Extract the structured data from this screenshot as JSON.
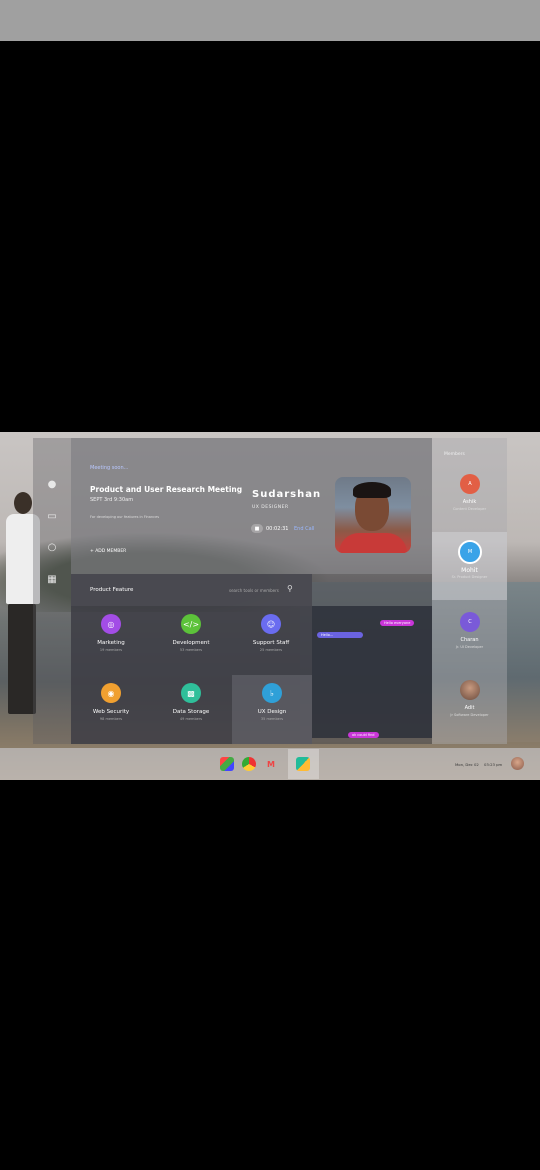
{
  "meeting": {
    "small_label": "Meeting soon...",
    "title": "Product and User Research Meeting",
    "date": "SEPT 3rd 9:30am",
    "note": "For developing our features in Finances",
    "add_member": "+ ADD MEMBER"
  },
  "host": {
    "name": "Sudarshan",
    "role": "UX DESIGNER",
    "call_time": "00:02:31",
    "end_call": "End Call"
  },
  "features": {
    "title": "Product Feature",
    "search_placeholder": "search tools or members",
    "items": [
      {
        "name": "Marketing",
        "members": "19 members",
        "color": "#a34de6"
      },
      {
        "name": "Development",
        "members": "53 members",
        "color": "#5cc23a"
      },
      {
        "name": "Support Staff",
        "members": "25 members",
        "color": "#6a6cf0"
      },
      {
        "name": "Web Security",
        "members": "98 members",
        "color": "#f0a030"
      },
      {
        "name": "Data Storage",
        "members": "49 members",
        "color": "#2fbf9a"
      },
      {
        "name": "UX Design",
        "members": "35 members",
        "color": "#2fa0d8"
      }
    ]
  },
  "chat": {
    "messages": [
      "Hello everyone",
      "Hello...",
      "ok could find"
    ]
  },
  "members": {
    "title": "Members",
    "items": [
      {
        "initial": "A",
        "name": "Ashik",
        "role": "Content Developer",
        "color": "#e25f45"
      },
      {
        "initial": "M",
        "name": "Mohit",
        "role": "Sr. Product Designer",
        "color": "#3aa3e8"
      },
      {
        "initial": "C",
        "name": "Charan",
        "role": "Jr. UI Developer",
        "color": "#7a5ad8"
      },
      {
        "initial": "",
        "name": "Adit",
        "role": "Jr Software Developer",
        "color": "#a88470"
      }
    ]
  },
  "taskbar": {
    "date": "Mon, Dec 02",
    "time": "03:23 pm"
  }
}
